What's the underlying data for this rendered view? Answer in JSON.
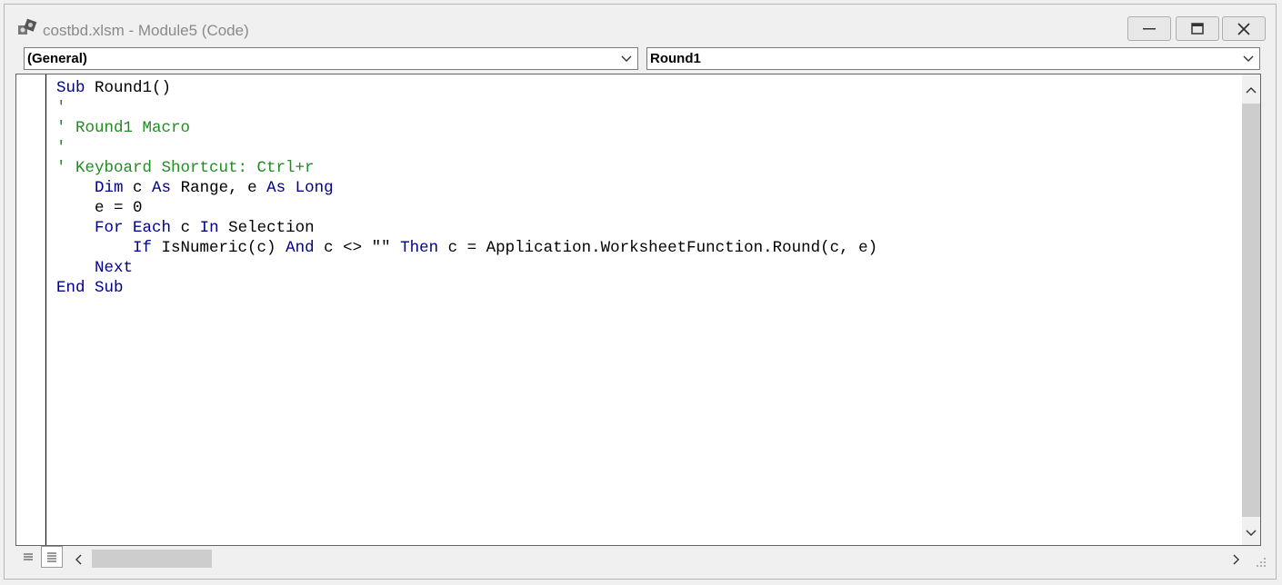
{
  "window": {
    "title": "costbd.xlsm - Module5 (Code)",
    "icon": "vba-module-icon"
  },
  "controls": {
    "minimize": "minimize-icon",
    "restore": "restore-icon",
    "close": "close-icon"
  },
  "object_dropdown": {
    "value": "(General)"
  },
  "procedure_dropdown": {
    "value": "Round1"
  },
  "code_lines": [
    [
      {
        "t": "Sub",
        "c": "kw"
      },
      {
        "t": " Round1()",
        "c": ""
      }
    ],
    [
      {
        "t": "'",
        "c": "cm"
      }
    ],
    [
      {
        "t": "' Round1 Macro",
        "c": "cm"
      }
    ],
    [
      {
        "t": "'",
        "c": "cm"
      }
    ],
    [
      {
        "t": "' Keyboard Shortcut: Ctrl+r",
        "c": "cm"
      }
    ],
    [
      {
        "t": "    ",
        "c": ""
      },
      {
        "t": "Dim",
        "c": "kw"
      },
      {
        "t": " c ",
        "c": ""
      },
      {
        "t": "As",
        "c": "kw"
      },
      {
        "t": " Range, e ",
        "c": ""
      },
      {
        "t": "As",
        "c": "kw"
      },
      {
        "t": " ",
        "c": ""
      },
      {
        "t": "Long",
        "c": "kw"
      }
    ],
    [
      {
        "t": "    e = 0",
        "c": ""
      }
    ],
    [
      {
        "t": "    ",
        "c": ""
      },
      {
        "t": "For",
        "c": "kw"
      },
      {
        "t": " ",
        "c": ""
      },
      {
        "t": "Each",
        "c": "kw"
      },
      {
        "t": " c ",
        "c": ""
      },
      {
        "t": "In",
        "c": "kw"
      },
      {
        "t": " Selection",
        "c": ""
      }
    ],
    [
      {
        "t": "        ",
        "c": ""
      },
      {
        "t": "If",
        "c": "kw"
      },
      {
        "t": " IsNumeric(c) ",
        "c": ""
      },
      {
        "t": "And",
        "c": "kw"
      },
      {
        "t": " c <> \"\" ",
        "c": ""
      },
      {
        "t": "Then",
        "c": "kw"
      },
      {
        "t": " c = Application.WorksheetFunction.Round(c, e)",
        "c": ""
      }
    ],
    [
      {
        "t": "    ",
        "c": ""
      },
      {
        "t": "Next",
        "c": "kw"
      }
    ],
    [
      {
        "t": "End",
        "c": "kw"
      },
      {
        "t": " ",
        "c": ""
      },
      {
        "t": "Sub",
        "c": "kw"
      }
    ]
  ],
  "colors": {
    "keyword": "#00008b",
    "comment": "#228b22",
    "text": "#000000"
  }
}
